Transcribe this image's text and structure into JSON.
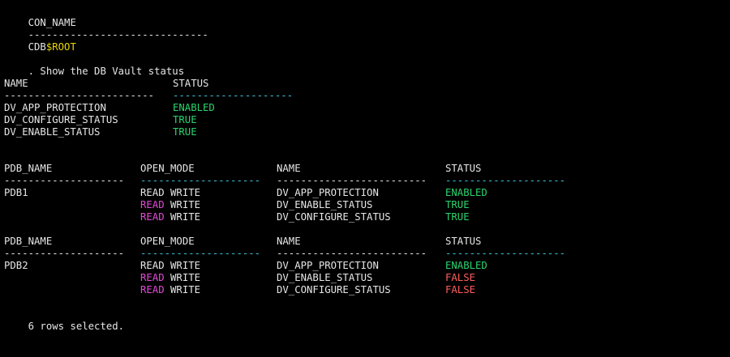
{
  "colors": {
    "background": "#000000",
    "text": "#e6e6e6",
    "cyan_dashes": "#3fc3d8",
    "yellow": "#e8d800",
    "green": "#2bd46e",
    "red": "#ff5c5c",
    "magenta": "#e24ad6"
  },
  "con_name": {
    "header": "CON_NAME",
    "dashes": "------------------------------",
    "value_prefix": "CDB",
    "value_suffix": "$ROOT"
  },
  "title_line": ". Show the DB Vault status",
  "cdb_table": {
    "headers": {
      "name": "NAME",
      "status": "STATUS"
    },
    "dashes": {
      "name": "-------------------------",
      "status": "--------------------"
    },
    "rows": [
      {
        "name": "DV_APP_PROTECTION",
        "status": "ENABLED"
      },
      {
        "name": "DV_CONFIGURE_STATUS",
        "status": "TRUE"
      },
      {
        "name": "DV_ENABLE_STATUS",
        "status": "TRUE"
      }
    ]
  },
  "pdb_tables": [
    {
      "headers": {
        "pdb_name": "PDB_NAME",
        "open_mode": "OPEN_MODE",
        "name": "NAME",
        "status": "STATUS"
      },
      "dashes": {
        "pdb_name": "--------------------",
        "open_mode": "--------------------",
        "name": "-------------------------",
        "status": "--------------------"
      },
      "rows": [
        {
          "pdb_name": "PDB1",
          "open_word1": "READ",
          "open_word2": "WRITE",
          "name": "DV_APP_PROTECTION",
          "status": "ENABLED"
        },
        {
          "pdb_name": "",
          "open_word1": "READ",
          "open_word2": "WRITE",
          "name": "DV_ENABLE_STATUS",
          "status": "TRUE"
        },
        {
          "pdb_name": "",
          "open_word1": "READ",
          "open_word2": "WRITE",
          "name": "DV_CONFIGURE_STATUS",
          "status": "TRUE"
        }
      ]
    },
    {
      "headers": {
        "pdb_name": "PDB_NAME",
        "open_mode": "OPEN_MODE",
        "name": "NAME",
        "status": "STATUS"
      },
      "dashes": {
        "pdb_name": "--------------------",
        "open_mode": "--------------------",
        "name": "-------------------------",
        "status": "--------------------"
      },
      "rows": [
        {
          "pdb_name": "PDB2",
          "open_word1": "READ",
          "open_word2": "WRITE",
          "name": "DV_APP_PROTECTION",
          "status": "ENABLED"
        },
        {
          "pdb_name": "",
          "open_word1": "READ",
          "open_word2": "WRITE",
          "name": "DV_ENABLE_STATUS",
          "status": "FALSE"
        },
        {
          "pdb_name": "",
          "open_word1": "READ",
          "open_word2": "WRITE",
          "name": "DV_CONFIGURE_STATUS",
          "status": "FALSE"
        }
      ]
    }
  ],
  "footer": "6 rows selected."
}
